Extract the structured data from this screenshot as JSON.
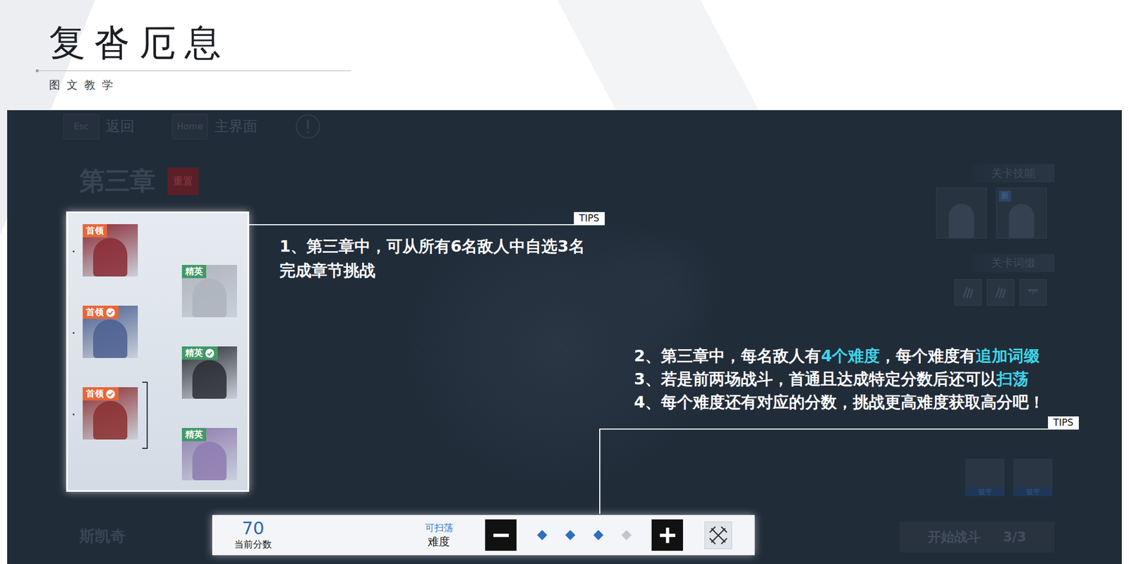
{
  "header": {
    "title": "复沓厄息",
    "subtitle": "图文教学"
  },
  "top_bar": {
    "keys": [
      {
        "key": "Esc",
        "label": "返回"
      },
      {
        "key": "Home",
        "label": "主界面"
      }
    ]
  },
  "chapter": {
    "title": "第三章",
    "reset": "重置"
  },
  "level_skills": {
    "label": "关卡技能",
    "new_badge": "新",
    "items": [
      {
        "new": false
      },
      {
        "new": true
      }
    ]
  },
  "level_affixes": {
    "label": "关卡词缀",
    "items": [
      {
        "kind": "claw"
      },
      {
        "kind": "claw"
      },
      {
        "kind": "fang"
      }
    ]
  },
  "guards": [
    {
      "label": "驻守"
    },
    {
      "label": "驻守"
    }
  ],
  "enemy_name": "斯凯奇",
  "start": {
    "label": "开始战斗",
    "count": "3/3"
  },
  "enemies": [
    {
      "rank": "首领",
      "color": "#e8663a",
      "cleared": false,
      "selected": false
    },
    {
      "rank": "精英",
      "color": "#3f9a66",
      "cleared": false,
      "selected": false
    },
    {
      "rank": "首领",
      "color": "#e8663a",
      "cleared": true,
      "selected": false
    },
    {
      "rank": "精英",
      "color": "#3f9a66",
      "cleared": true,
      "selected": false
    },
    {
      "rank": "首领",
      "color": "#e8663a",
      "cleared": true,
      "selected": true
    },
    {
      "rank": "精英",
      "color": "#3f9a66",
      "cleared": false,
      "selected": false
    }
  ],
  "tips": [
    {
      "label": "TIPS",
      "lines": [
        [
          {
            "text": "1、第三章中，可从所有6名敌人中自选3名",
            "highlight": false
          }
        ],
        [
          {
            "text": "完成章节挑战",
            "highlight": false
          }
        ]
      ]
    },
    {
      "label": "TIPS",
      "lines": [
        [
          {
            "text": "2、第三章中，每名敌人有",
            "highlight": false
          },
          {
            "text": "4个难度",
            "highlight": true
          },
          {
            "text": "，每个难度有",
            "highlight": false
          },
          {
            "text": "追加词缀",
            "highlight": true
          }
        ],
        [
          {
            "text": "3、若是前两场战斗，首通且达成特定分数后还可以",
            "highlight": false
          },
          {
            "text": "扫荡",
            "highlight": true
          }
        ],
        [
          {
            "text": "4、每个难度还有对应的分数，挑战更高难度获取高分吧！",
            "highlight": false
          }
        ]
      ]
    }
  ],
  "score_bar": {
    "score": "70",
    "score_label": "当前分数",
    "sweep": "可扫荡",
    "difficulty_label": "难度",
    "levels": [
      {
        "filled": true
      },
      {
        "filled": true
      },
      {
        "filled": true
      },
      {
        "filled": false
      }
    ]
  }
}
